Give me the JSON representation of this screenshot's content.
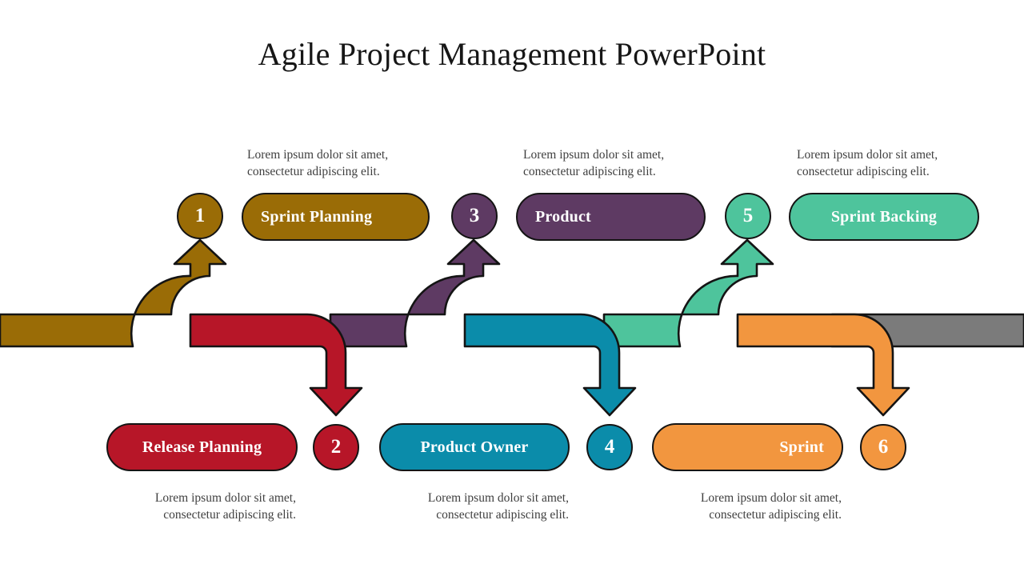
{
  "slide": {
    "title": "Agile Project Management PowerPoint",
    "background": "#ffffff",
    "outline_color": "#141414"
  },
  "palette": {
    "gold": "#9a6c06",
    "red": "#b71628",
    "purple": "#5e3a63",
    "teal": "#0b8caa",
    "green": "#4ec49c",
    "orange": "#f2963f",
    "gray": "#7b7b7b"
  },
  "caption_text": "Lorem ipsum dolor sit amet,\nconsectetur adipiscing elit.",
  "top_row": [
    {
      "number": "1",
      "label": "Sprint Planning",
      "color": "#9a6c06",
      "caption": "Lorem ipsum dolor sit amet,\nconsectetur adipiscing elit."
    },
    {
      "number": "3",
      "label": "Product",
      "color": "#5e3a63",
      "caption": "Lorem ipsum dolor sit amet,\nconsectetur adipiscing elit."
    },
    {
      "number": "5",
      "label": "Sprint Backing",
      "color": "#4ec49c",
      "caption": "Lorem ipsum dolor sit amet,\nconsectetur adipiscing elit."
    }
  ],
  "bottom_row": [
    {
      "number": "2",
      "label": "Release Planning",
      "color": "#b71628",
      "caption": "Lorem ipsum dolor sit amet,\nconsectetur adipiscing elit."
    },
    {
      "number": "4",
      "label": "Product Owner",
      "color": "#0b8caa",
      "caption": "Lorem ipsum dolor sit amet,\nconsectetur adipiscing elit."
    },
    {
      "number": "6",
      "label": "Sprint",
      "color": "#f2963f",
      "caption": "Lorem ipsum dolor sit amet,\nconsectetur adipiscing elit."
    }
  ],
  "timeline": {
    "segments": [
      {
        "name": "gold-segment",
        "color": "#9a6c06"
      },
      {
        "name": "red-segment",
        "color": "#b71628"
      },
      {
        "name": "purple-segment",
        "color": "#5e3a63"
      },
      {
        "name": "teal-segment",
        "color": "#0b8caa"
      },
      {
        "name": "green-segment",
        "color": "#4ec49c"
      },
      {
        "name": "orange-segment",
        "color": "#f2963f"
      },
      {
        "name": "gray-segment",
        "color": "#7b7b7b"
      }
    ]
  }
}
